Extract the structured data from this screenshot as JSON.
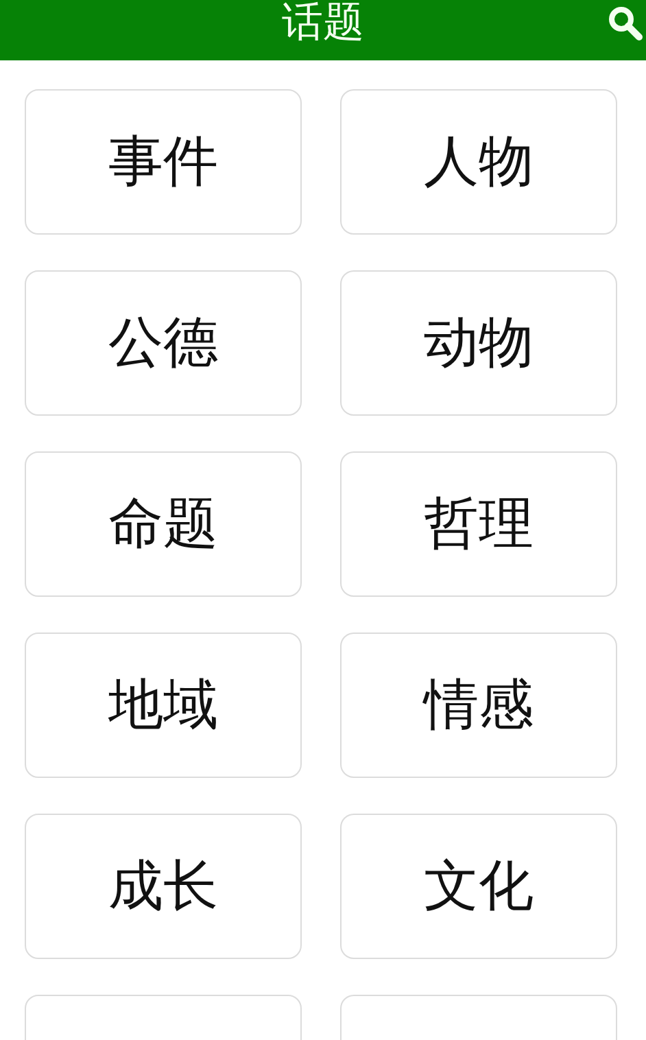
{
  "header": {
    "title": "话题"
  },
  "topics": [
    {
      "label": "事件"
    },
    {
      "label": "人物"
    },
    {
      "label": "公德"
    },
    {
      "label": "动物"
    },
    {
      "label": "命题"
    },
    {
      "label": "哲理"
    },
    {
      "label": "地域"
    },
    {
      "label": "情感"
    },
    {
      "label": "成长"
    },
    {
      "label": "文化"
    }
  ],
  "cut_cards": [
    {
      "kind": "card"
    },
    {
      "kind": "card"
    }
  ]
}
